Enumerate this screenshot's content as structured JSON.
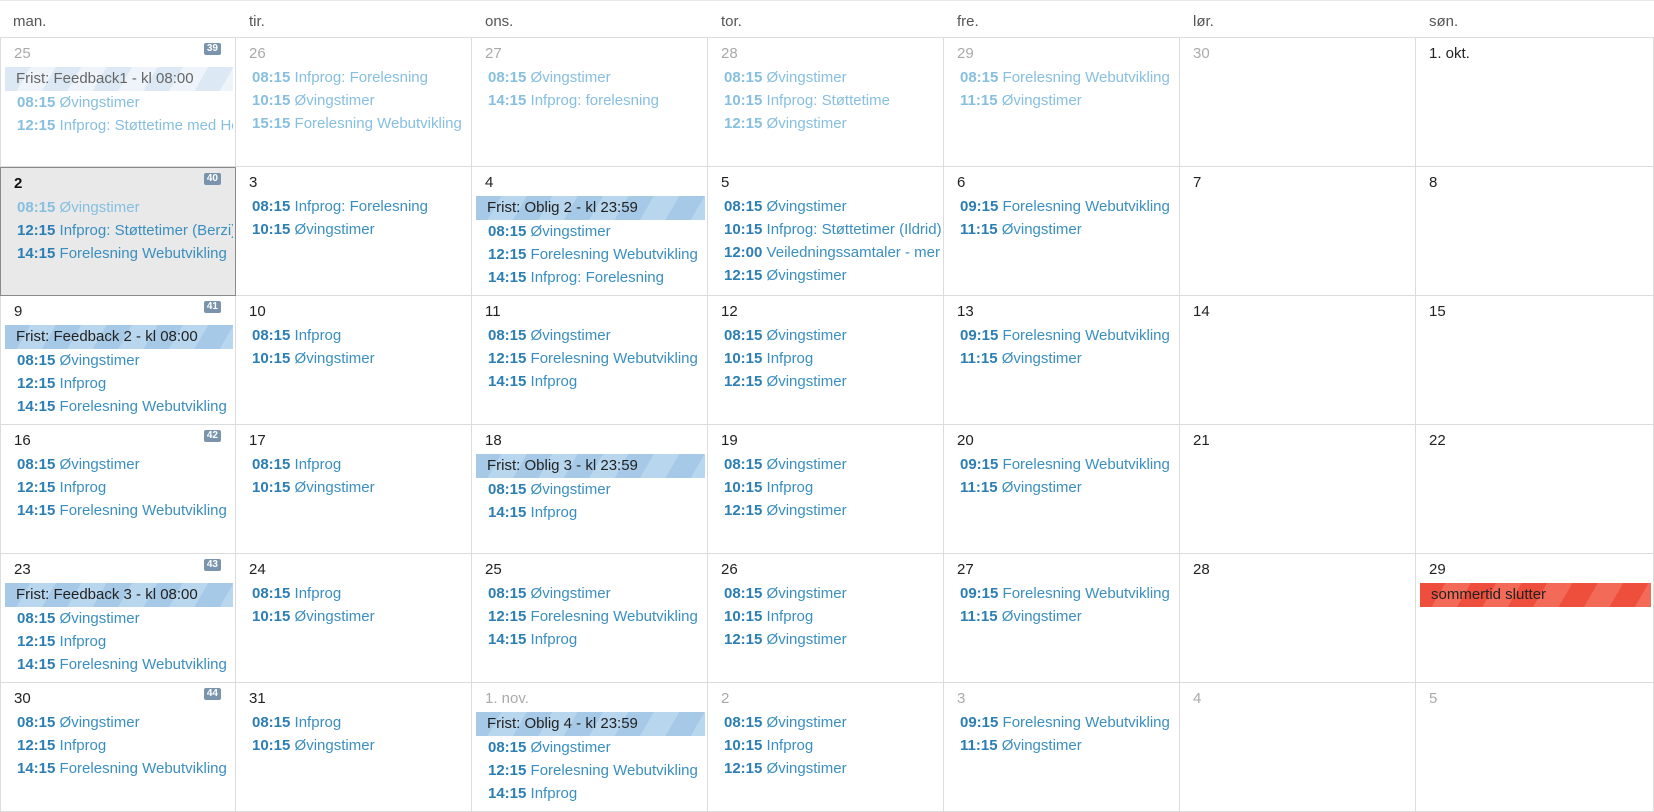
{
  "weekdays": [
    "man.",
    "tir.",
    "ons.",
    "tor.",
    "fre.",
    "lør.",
    "søn."
  ],
  "weeks": [
    {
      "number": "39",
      "days": [
        {
          "label": "25",
          "past": true,
          "allday": [
            {
              "text": "Frist: Feedback1 - kl 08:00",
              "style": "past"
            }
          ],
          "events": [
            {
              "time": "08:15",
              "title": "Øvingstimer"
            },
            {
              "time": "12:15",
              "title": "Infprog: Støttetime med He"
            }
          ]
        },
        {
          "label": "26",
          "past": true,
          "allday": [],
          "events": [
            {
              "time": "08:15",
              "title": "Infprog: Forelesning"
            },
            {
              "time": "10:15",
              "title": "Øvingstimer"
            },
            {
              "time": "15:15",
              "title": "Forelesning Webutvikling"
            }
          ]
        },
        {
          "label": "27",
          "past": true,
          "allday": [],
          "events": [
            {
              "time": "08:15",
              "title": "Øvingstimer"
            },
            {
              "time": "14:15",
              "title": "Infprog: forelesning"
            }
          ]
        },
        {
          "label": "28",
          "past": true,
          "allday": [],
          "events": [
            {
              "time": "08:15",
              "title": "Øvingstimer"
            },
            {
              "time": "10:15",
              "title": "Infprog: Støttetime"
            },
            {
              "time": "12:15",
              "title": "Øvingstimer"
            }
          ]
        },
        {
          "label": "29",
          "past": true,
          "allday": [],
          "events": [
            {
              "time": "08:15",
              "title": "Forelesning Webutvikling"
            },
            {
              "time": "11:15",
              "title": "Øvingstimer"
            }
          ]
        },
        {
          "label": "30",
          "past": true,
          "allday": [],
          "events": []
        },
        {
          "label": "1. okt.",
          "past": false,
          "allday": [],
          "events": []
        }
      ]
    },
    {
      "number": "40",
      "days": [
        {
          "label": "2",
          "today": true,
          "allday": [],
          "events": [
            {
              "time": "08:15",
              "title": "Øvingstimer"
            },
            {
              "time": "12:15",
              "title": "Infprog: Støttetimer (Berzi)"
            },
            {
              "time": "14:15",
              "title": "Forelesning Webutvikling"
            }
          ]
        },
        {
          "label": "3",
          "allday": [],
          "events": [
            {
              "time": "08:15",
              "title": "Infprog: Forelesning"
            },
            {
              "time": "10:15",
              "title": "Øvingstimer"
            }
          ]
        },
        {
          "label": "4",
          "allday": [
            {
              "text": "Frist: Oblig 2 - kl 23:59",
              "style": "blue"
            }
          ],
          "events": [
            {
              "time": "08:15",
              "title": "Øvingstimer"
            },
            {
              "time": "12:15",
              "title": "Forelesning Webutvikling"
            },
            {
              "time": "14:15",
              "title": "Infprog: Forelesning"
            }
          ]
        },
        {
          "label": "5",
          "allday": [],
          "events": [
            {
              "time": "08:15",
              "title": "Øvingstimer"
            },
            {
              "time": "10:15",
              "title": "Infprog: Støttetimer (Ildrid)"
            },
            {
              "time": "12:00",
              "title": "Veiledningssamtaler - mer"
            },
            {
              "time": "12:15",
              "title": "Øvingstimer"
            }
          ]
        },
        {
          "label": "6",
          "allday": [],
          "events": [
            {
              "time": "09:15",
              "title": "Forelesning Webutvikling"
            },
            {
              "time": "11:15",
              "title": "Øvingstimer"
            }
          ]
        },
        {
          "label": "7",
          "allday": [],
          "events": []
        },
        {
          "label": "8",
          "allday": [],
          "events": []
        }
      ]
    },
    {
      "number": "41",
      "days": [
        {
          "label": "9",
          "allday": [
            {
              "text": "Frist: Feedback 2 - kl 08:00",
              "style": "blue"
            }
          ],
          "events": [
            {
              "time": "08:15",
              "title": "Øvingstimer"
            },
            {
              "time": "12:15",
              "title": "Infprog"
            },
            {
              "time": "14:15",
              "title": "Forelesning Webutvikling"
            }
          ]
        },
        {
          "label": "10",
          "allday": [],
          "events": [
            {
              "time": "08:15",
              "title": "Infprog"
            },
            {
              "time": "10:15",
              "title": "Øvingstimer"
            }
          ]
        },
        {
          "label": "11",
          "allday": [],
          "events": [
            {
              "time": "08:15",
              "title": "Øvingstimer"
            },
            {
              "time": "12:15",
              "title": "Forelesning Webutvikling"
            },
            {
              "time": "14:15",
              "title": "Infprog"
            }
          ]
        },
        {
          "label": "12",
          "allday": [],
          "events": [
            {
              "time": "08:15",
              "title": "Øvingstimer"
            },
            {
              "time": "10:15",
              "title": "Infprog"
            },
            {
              "time": "12:15",
              "title": "Øvingstimer"
            }
          ]
        },
        {
          "label": "13",
          "allday": [],
          "events": [
            {
              "time": "09:15",
              "title": "Forelesning Webutvikling"
            },
            {
              "time": "11:15",
              "title": "Øvingstimer"
            }
          ]
        },
        {
          "label": "14",
          "allday": [],
          "events": []
        },
        {
          "label": "15",
          "allday": [],
          "events": []
        }
      ]
    },
    {
      "number": "42",
      "days": [
        {
          "label": "16",
          "allday": [],
          "events": [
            {
              "time": "08:15",
              "title": "Øvingstimer"
            },
            {
              "time": "12:15",
              "title": "Infprog"
            },
            {
              "time": "14:15",
              "title": "Forelesning Webutvikling"
            }
          ]
        },
        {
          "label": "17",
          "allday": [],
          "events": [
            {
              "time": "08:15",
              "title": "Infprog"
            },
            {
              "time": "10:15",
              "title": "Øvingstimer"
            }
          ]
        },
        {
          "label": "18",
          "allday": [
            {
              "text": "Frist: Oblig 3 - kl 23:59",
              "style": "blue"
            }
          ],
          "events": [
            {
              "time": "08:15",
              "title": "Øvingstimer"
            },
            {
              "time": "14:15",
              "title": "Infprog"
            }
          ]
        },
        {
          "label": "19",
          "allday": [],
          "events": [
            {
              "time": "08:15",
              "title": "Øvingstimer"
            },
            {
              "time": "10:15",
              "title": "Infprog"
            },
            {
              "time": "12:15",
              "title": "Øvingstimer"
            }
          ]
        },
        {
          "label": "20",
          "allday": [],
          "events": [
            {
              "time": "09:15",
              "title": "Forelesning Webutvikling"
            },
            {
              "time": "11:15",
              "title": "Øvingstimer"
            }
          ]
        },
        {
          "label": "21",
          "allday": [],
          "events": []
        },
        {
          "label": "22",
          "allday": [],
          "events": []
        }
      ]
    },
    {
      "number": "43",
      "days": [
        {
          "label": "23",
          "allday": [
            {
              "text": "Frist: Feedback 3 - kl 08:00",
              "style": "blue"
            }
          ],
          "events": [
            {
              "time": "08:15",
              "title": "Øvingstimer"
            },
            {
              "time": "12:15",
              "title": "Infprog"
            },
            {
              "time": "14:15",
              "title": "Forelesning Webutvikling"
            }
          ]
        },
        {
          "label": "24",
          "allday": [],
          "events": [
            {
              "time": "08:15",
              "title": "Infprog"
            },
            {
              "time": "10:15",
              "title": "Øvingstimer"
            }
          ]
        },
        {
          "label": "25",
          "allday": [],
          "events": [
            {
              "time": "08:15",
              "title": "Øvingstimer"
            },
            {
              "time": "12:15",
              "title": "Forelesning Webutvikling"
            },
            {
              "time": "14:15",
              "title": "Infprog"
            }
          ]
        },
        {
          "label": "26",
          "allday": [],
          "events": [
            {
              "time": "08:15",
              "title": "Øvingstimer"
            },
            {
              "time": "10:15",
              "title": "Infprog"
            },
            {
              "time": "12:15",
              "title": "Øvingstimer"
            }
          ]
        },
        {
          "label": "27",
          "allday": [],
          "events": [
            {
              "time": "09:15",
              "title": "Forelesning Webutvikling"
            },
            {
              "time": "11:15",
              "title": "Øvingstimer"
            }
          ]
        },
        {
          "label": "28",
          "allday": [],
          "events": []
        },
        {
          "label": "29",
          "allday": [
            {
              "text": "sommertid slutter",
              "style": "red"
            }
          ],
          "events": []
        }
      ]
    },
    {
      "number": "44",
      "days": [
        {
          "label": "30",
          "allday": [],
          "events": [
            {
              "time": "08:15",
              "title": "Øvingstimer"
            },
            {
              "time": "12:15",
              "title": "Infprog"
            },
            {
              "time": "14:15",
              "title": "Forelesning Webutvikling"
            }
          ]
        },
        {
          "label": "31",
          "allday": [],
          "events": [
            {
              "time": "08:15",
              "title": "Infprog"
            },
            {
              "time": "10:15",
              "title": "Øvingstimer"
            }
          ]
        },
        {
          "label": "1. nov.",
          "other": true,
          "allday": [
            {
              "text": "Frist: Oblig 4 - kl 23:59",
              "style": "blue"
            }
          ],
          "events": [
            {
              "time": "08:15",
              "title": "Øvingstimer"
            },
            {
              "time": "12:15",
              "title": "Forelesning Webutvikling"
            },
            {
              "time": "14:15",
              "title": "Infprog"
            }
          ]
        },
        {
          "label": "2",
          "other": true,
          "allday": [],
          "events": [
            {
              "time": "08:15",
              "title": "Øvingstimer"
            },
            {
              "time": "10:15",
              "title": "Infprog"
            },
            {
              "time": "12:15",
              "title": "Øvingstimer"
            }
          ]
        },
        {
          "label": "3",
          "other": true,
          "allday": [],
          "events": [
            {
              "time": "09:15",
              "title": "Forelesning Webutvikling"
            },
            {
              "time": "11:15",
              "title": "Øvingstimer"
            }
          ]
        },
        {
          "label": "4",
          "other": true,
          "allday": [],
          "events": []
        },
        {
          "label": "5",
          "other": true,
          "allday": [],
          "events": []
        }
      ]
    }
  ]
}
